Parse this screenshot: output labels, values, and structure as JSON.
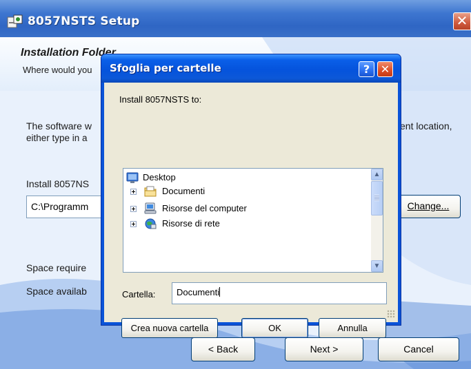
{
  "setup": {
    "title": "8057NSTS Setup",
    "close_symbol": "✕",
    "header_title": "Installation Folder",
    "header_subtitle": "Where would you",
    "desc_line1": "The software w",
    "desc_line2": "either type in a",
    "desc_right": "ent location,",
    "install_label": "Install 8057NS",
    "path_value": "C:\\Programm",
    "change_button": "Change...",
    "space_required": "Space require",
    "space_available": "Space availab",
    "back_button": "< Back",
    "next_button": "Next >",
    "cancel_button": "Cancel"
  },
  "browse_dialog": {
    "title": "Sfoglia per cartelle",
    "help_symbol": "?",
    "close_symbol": "✕",
    "prompt": "Install 8057NSTS to:",
    "tree": [
      {
        "label": "Desktop",
        "icon": "desktop-icon"
      },
      {
        "label": "Documenti",
        "icon": "documents-folder-icon"
      },
      {
        "label": "Risorse del computer",
        "icon": "my-computer-icon"
      },
      {
        "label": "Risorse di rete",
        "icon": "network-places-icon"
      }
    ],
    "folder_label": "Cartella:",
    "folder_value": "Documenti",
    "new_folder_button": "Crea nuova cartella",
    "ok_button": "OK",
    "cancel_button": "Annulla",
    "scroll_up_symbol": "▲",
    "scroll_down_symbol": "▼"
  },
  "colors": {
    "titlebar_blue": "#0553dc",
    "close_red": "#dc4d26",
    "dialog_face": "#ece9d8",
    "setup_background": "#dce9f8"
  }
}
